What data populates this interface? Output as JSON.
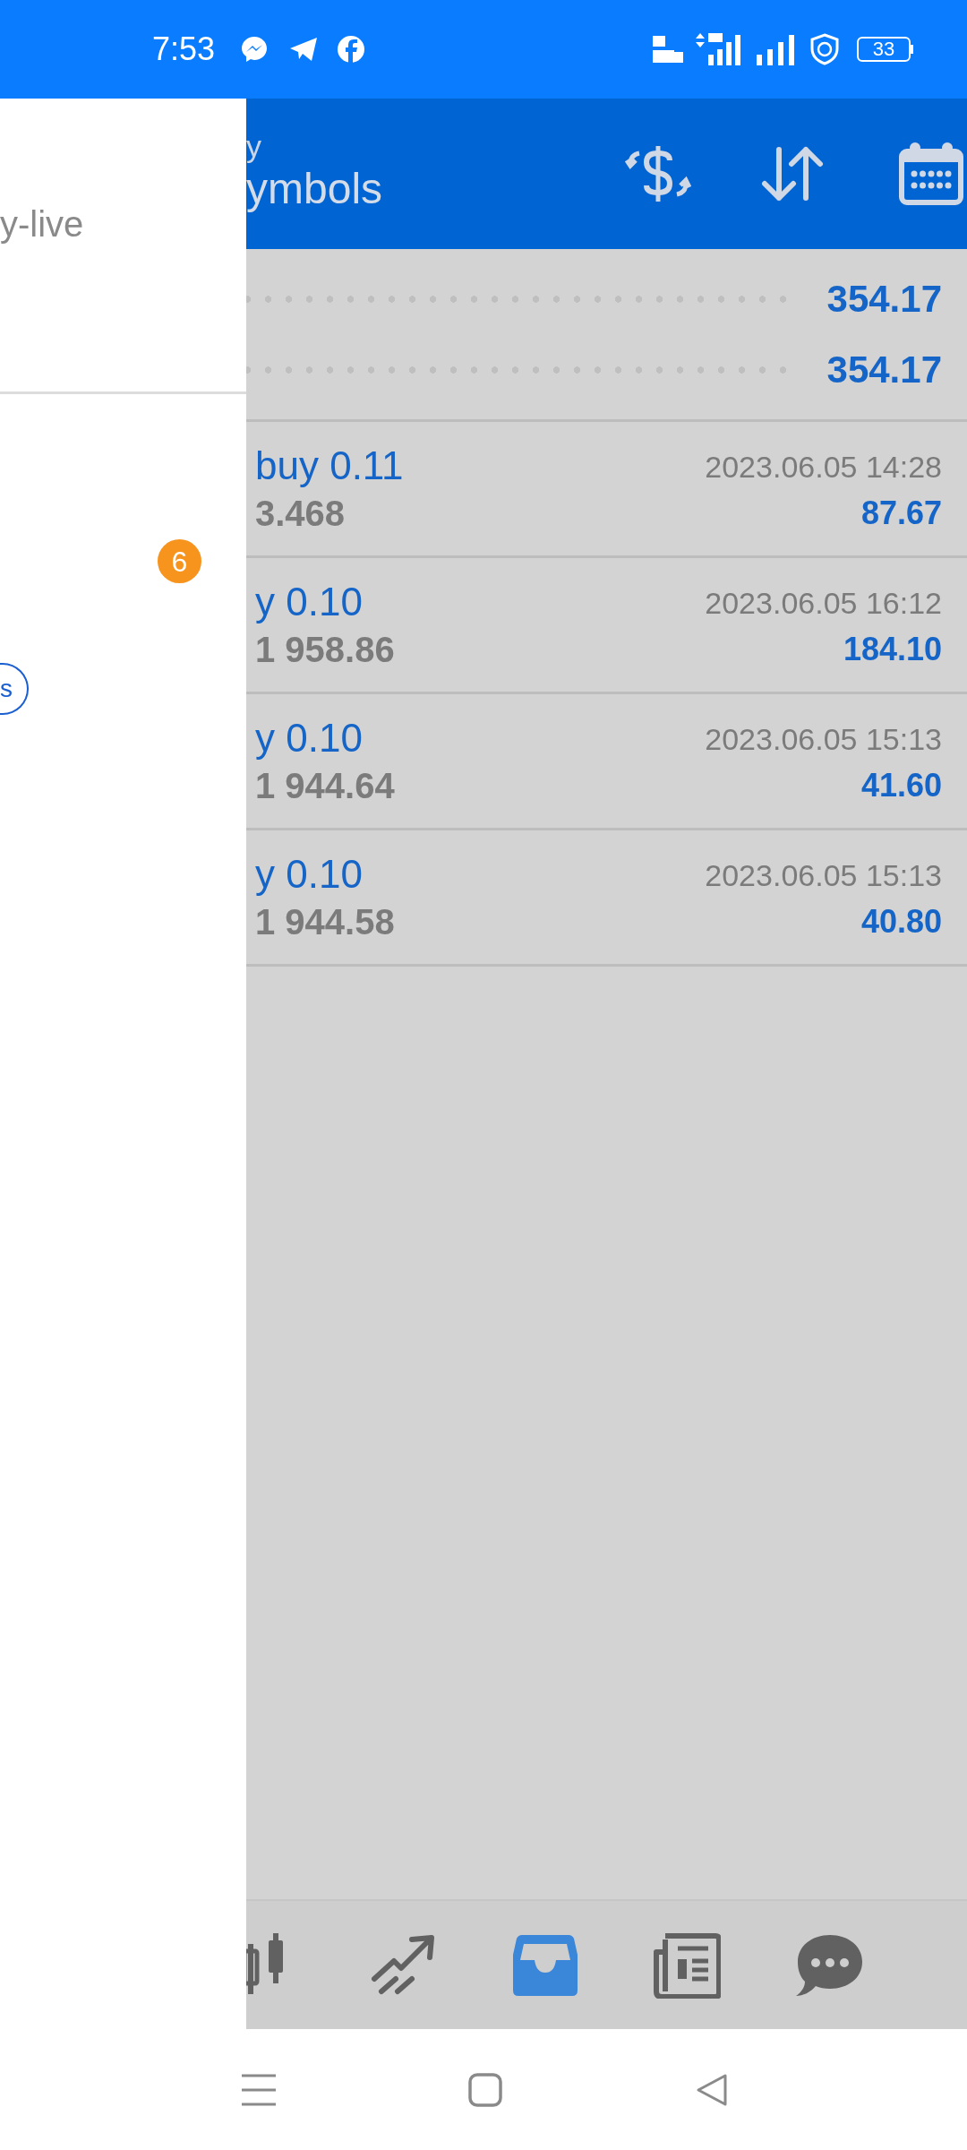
{
  "status_bar": {
    "time": "7:53",
    "battery": "33"
  },
  "drawer": {
    "account": "y-live",
    "badge": "6",
    "chip": "s"
  },
  "header": {
    "title": "y",
    "subtitle": "ymbols"
  },
  "summary": [
    {
      "value": "354.17"
    },
    {
      "value": "354.17"
    }
  ],
  "trades": [
    {
      "title": "buy 0.11",
      "price": "3.468",
      "time": "2023.06.05 14:28",
      "profit": "87.67"
    },
    {
      "title": "y 0.10",
      "price": "1 958.86",
      "time": "2023.06.05 16:12",
      "profit": "184.10"
    },
    {
      "title": "y 0.10",
      "price": "1 944.64",
      "time": "2023.06.05 15:13",
      "profit": "41.60"
    },
    {
      "title": "y 0.10",
      "price": "1 944.58",
      "time": "2023.06.05 15:13",
      "profit": "40.80"
    }
  ],
  "bottom_nav": [
    {
      "kind": "candles",
      "selected": false
    },
    {
      "kind": "trend",
      "selected": false
    },
    {
      "kind": "inbox",
      "selected": true
    },
    {
      "kind": "news",
      "selected": false
    },
    {
      "kind": "chat",
      "selected": false
    }
  ]
}
